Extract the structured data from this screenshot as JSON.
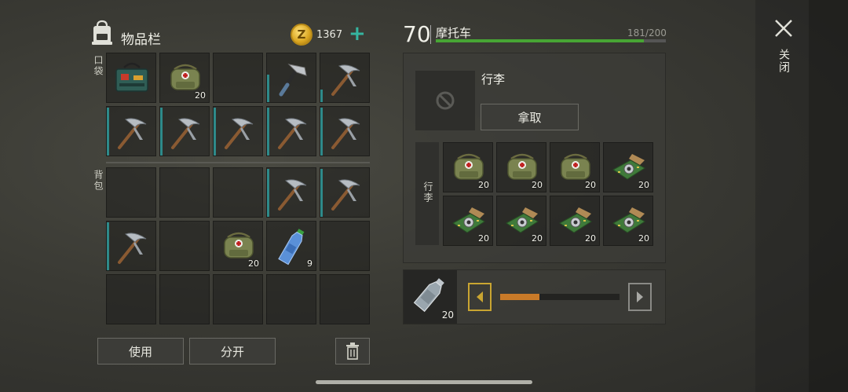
{
  "inventory": {
    "title": "物品栏",
    "coins": "1367",
    "coin_symbol": "Z",
    "add_symbol": "+",
    "pockets_label": "口袋",
    "backpack_label": "背包",
    "use_label": "使用",
    "split_label": "分开",
    "pockets": [
      {
        "item": "toolbox",
        "qty": "",
        "durability": 0
      },
      {
        "item": "medbag",
        "qty": "20",
        "durability": 0
      },
      {
        "item": "",
        "qty": "",
        "durability": 0
      },
      {
        "item": "hatchet",
        "qty": "",
        "durability": 0.55
      },
      {
        "item": "pickaxe",
        "qty": "",
        "durability": 0.25
      },
      {
        "item": "pickaxe",
        "qty": "",
        "durability": 0.95
      },
      {
        "item": "pickaxe",
        "qty": "",
        "durability": 0.95
      },
      {
        "item": "pickaxe",
        "qty": "",
        "durability": 0.95
      },
      {
        "item": "pickaxe",
        "qty": "",
        "durability": 0.95
      },
      {
        "item": "pickaxe",
        "qty": "",
        "durability": 0.95
      }
    ],
    "backpack": [
      {
        "item": "",
        "qty": "",
        "durability": 0
      },
      {
        "item": "",
        "qty": "",
        "durability": 0
      },
      {
        "item": "",
        "qty": "",
        "durability": 0
      },
      {
        "item": "pickaxe",
        "qty": "",
        "durability": 0.95
      },
      {
        "item": "pickaxe",
        "qty": "",
        "durability": 0.95
      },
      {
        "item": "pickaxe",
        "qty": "",
        "durability": 0.95
      },
      {
        "item": "",
        "qty": "",
        "durability": 0
      },
      {
        "item": "medbag",
        "qty": "20",
        "durability": 0
      },
      {
        "item": "water-bottle",
        "qty": "9",
        "durability": 0
      },
      {
        "item": "",
        "qty": "",
        "durability": 0
      },
      {
        "item": "",
        "qty": "",
        "durability": 0
      },
      {
        "item": "",
        "qty": "",
        "durability": 0
      },
      {
        "item": "",
        "qty": "",
        "durability": 0
      },
      {
        "item": "",
        "qty": "",
        "durability": 0
      },
      {
        "item": "",
        "qty": "",
        "durability": 0
      }
    ]
  },
  "vehicle": {
    "level": "70",
    "name": "摩托车",
    "hp_text": "181/200",
    "hp_fraction": 0.905,
    "trunk_label": "行李",
    "take_label": "拿取",
    "cargo_label": "行李",
    "cargo": [
      {
        "item": "medbag",
        "qty": "20"
      },
      {
        "item": "medbag",
        "qty": "20"
      },
      {
        "item": "medbag",
        "qty": "20"
      },
      {
        "item": "circuit-board",
        "qty": "20"
      },
      {
        "item": "circuit-board",
        "qty": "20"
      },
      {
        "item": "circuit-board",
        "qty": "20"
      },
      {
        "item": "circuit-board",
        "qty": "20"
      },
      {
        "item": "circuit-board",
        "qty": "20"
      }
    ]
  },
  "transfer": {
    "item": "empty-bottle",
    "qty": "20",
    "amount_fraction": 0.33
  },
  "close_label": "关闭",
  "colors": {
    "accent": "#35b5a0",
    "hp": "#47a534",
    "slider": "#c97a28",
    "arrow_left": "#c9a531",
    "durability": "#2e8a8a"
  }
}
